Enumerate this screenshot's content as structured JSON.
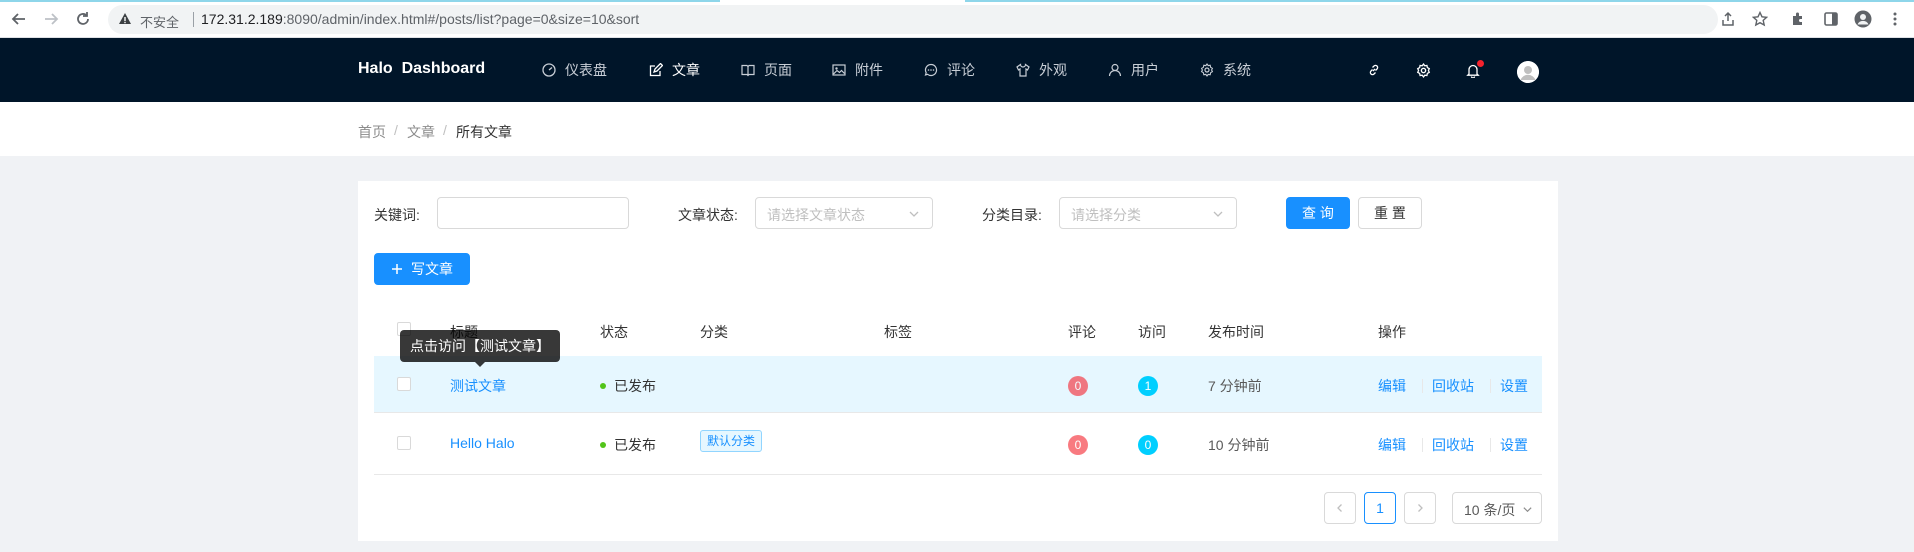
{
  "browser": {
    "security_label": "不安全",
    "url_host": "172.31.2.189",
    "url_rest": ":8090/admin/index.html#/posts/list?page=0&size=10&sort"
  },
  "header": {
    "brand": "Halo  Dashboard",
    "menu": [
      {
        "label": "仪表盘",
        "icon": "dashboard-icon"
      },
      {
        "label": "文章",
        "icon": "edit-icon",
        "active": true
      },
      {
        "label": "页面",
        "icon": "read-icon"
      },
      {
        "label": "附件",
        "icon": "picture-icon"
      },
      {
        "label": "评论",
        "icon": "message-icon"
      },
      {
        "label": "外观",
        "icon": "skin-icon"
      },
      {
        "label": "用户",
        "icon": "user-icon"
      },
      {
        "label": "系统",
        "icon": "setting-icon"
      }
    ]
  },
  "breadcrumb": [
    "首页",
    "文章",
    "所有文章"
  ],
  "filters": {
    "keyword_label": "关键词:",
    "keyword_value": "",
    "status_label": "文章状态:",
    "status_placeholder": "请选择文章状态",
    "category_label": "分类目录:",
    "category_placeholder": "请选择分类",
    "query_button": "查 询",
    "reset_button": "重 置"
  },
  "write_button": "写文章",
  "table": {
    "columns": [
      "标题",
      "状态",
      "分类",
      "标签",
      "评论",
      "访问",
      "发布时间",
      "操作"
    ],
    "rows": [
      {
        "title": "测试文章",
        "status": "已发布",
        "category": "",
        "tags": "",
        "comments": "0",
        "visits": "1",
        "published": "7 分钟前",
        "ops": [
          "编辑",
          "回收站",
          "设置"
        ]
      },
      {
        "title": "Hello Halo",
        "status": "已发布",
        "category": "默认分类",
        "tags": "",
        "comments": "0",
        "visits": "0",
        "published": "10 分钟前",
        "ops": [
          "编辑",
          "回收站",
          "设置"
        ]
      }
    ]
  },
  "tooltip": "点击访问【测试文章】",
  "pagination": {
    "current": "1",
    "page_size": "10 条/页"
  },
  "colors": {
    "primary": "#1890ff",
    "header_bg": "#001529",
    "published": "#52c41a"
  }
}
